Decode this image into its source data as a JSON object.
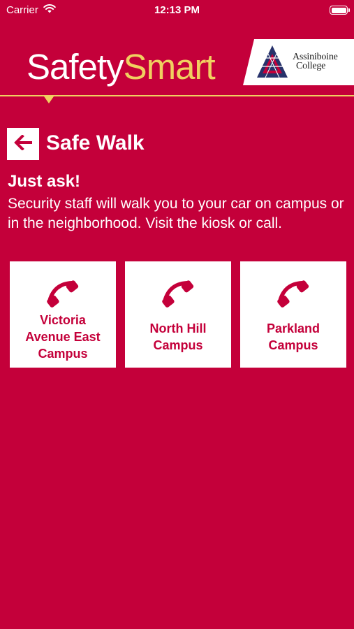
{
  "status_bar": {
    "carrier": "Carrier",
    "time": "12:13 PM",
    "battery_level": 1.0
  },
  "header": {
    "brand_part1": "Safety",
    "brand_part2": "Smart",
    "college_line1": "Assiniboine",
    "college_line2": "College",
    "icons": [
      "wifi-icon",
      "battery-icon",
      "college-logo-mark"
    ]
  },
  "page": {
    "back_icon": "arrow-left-icon",
    "title": "Safe Walk",
    "subheading": "Just ask!",
    "description": "Security staff will walk you to your car on campus or in the neighborhood. Visit the kiosk or call."
  },
  "campuses": [
    {
      "name": "Victoria Avenue East Campus",
      "icon": "phone-icon"
    },
    {
      "name": "North Hill Campus",
      "icon": "phone-icon"
    },
    {
      "name": "Parkland Campus",
      "icon": "phone-icon"
    }
  ],
  "colors": {
    "background": "#c4003a",
    "accent_yellow": "#f0d060",
    "card": "#ffffff",
    "college_navy": "#27326b",
    "college_red": "#c4003a"
  }
}
